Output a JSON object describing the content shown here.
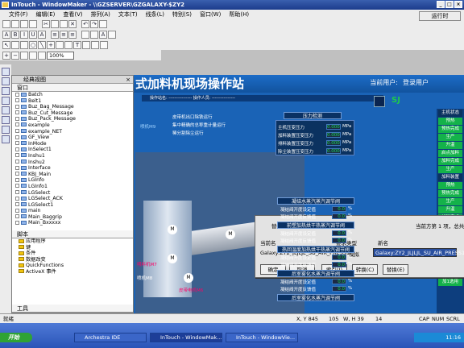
{
  "window": {
    "title": "InTouch - WindowMaker - \\\\GZSERVER\\GZGALAXY-$ZY2"
  },
  "menu": [
    "文件(F)",
    "编辑(E)",
    "查看(V)",
    "排列(A)",
    "文本(T)",
    "线条(L)",
    "特别(S)",
    "窗口(W)",
    "帮助(H)"
  ],
  "toolbar": {
    "run_label": "运行时",
    "zoom_value": "100%"
  },
  "classic_view": {
    "title": "经典视图",
    "window_header": "窗口",
    "script_header": "脚本",
    "tools_header": "工具"
  },
  "window_list": [
    "Batch",
    "Belt1",
    "Buz_Bag_Message",
    "Buz_Cut_Message",
    "Buz_Pack_Message",
    "example",
    "example_NET",
    "GF_View",
    "InMode",
    "InSelect1",
    "Inshu1",
    "Inshu2",
    "Interface",
    "KBJ_Main",
    "LGInfo",
    "LGInfo1",
    "LGSelect",
    "LGSelect_ACK",
    "LGSelect1",
    "main",
    "Main_Baggrip",
    "Main_Bxxxxx"
  ],
  "script_list": [
    "应用程序",
    "键",
    "条件",
    "数据改变",
    "QuickFunctions",
    "ActiveX 事件"
  ],
  "canvas": {
    "title": "式加料机现场操作站",
    "user_label": "当前用户:",
    "user_value": "登录用户",
    "subbar_text": "操作站名: ---------------- 操作人员: ----------------",
    "motor_lines": [
      "皮带机出口除铁运行",
      "集中精确的总称重计量运行",
      "稀分割除尘运行"
    ],
    "motor_labels": [
      "喷机M9",
      "喷机M8",
      "喂料机M7",
      "皮带电机M6"
    ],
    "tall_section": "压力检测",
    "pressure_rows": [
      {
        "label": "主机压变压力",
        "value": "0.000",
        "unit": "MPa"
      },
      {
        "label": "加料装置压变压力",
        "value": "0.000",
        "unit": "MPa"
      },
      {
        "label": "排料装置压变压力",
        "value": "0.000",
        "unit": "MPa"
      },
      {
        "label": "除尘装置压变压力",
        "value": "0.000",
        "unit": "MPa"
      }
    ],
    "sections": [
      {
        "title": "凝结水蒸汽蒸汽调节阀",
        "rows": [
          {
            "label": "凝结阀开度设定值",
            "value": "0.0",
            "unit": "%"
          },
          {
            "label": "凝结阀开度反馈值",
            "value": "0.0",
            "unit": "%"
          }
        ]
      },
      {
        "title": "前塑加热烘干热蒸汽调节阀",
        "rows": [
          {
            "label": "凝结阀开度设定值",
            "value": "0.0",
            "unit": "%"
          },
          {
            "label": "凝结阀开度反馈值",
            "value": "0.0",
            "unit": "%"
          }
        ]
      },
      {
        "title": "热回温度加热烘干热蒸汽调节阀",
        "rows": [
          {
            "label": "凝结阀开度设定值",
            "value": "0.0",
            "unit": "%"
          },
          {
            "label": "凝结阀开度反馈值",
            "value": "0.0",
            "unit": "%"
          }
        ]
      },
      {
        "title": "后室雾化水蒸汽调节阀",
        "rows": [
          {
            "label": "凝结阀开度设定值",
            "value": "0.0",
            "unit": "%"
          },
          {
            "label": "凝结阀开度反馈值",
            "value": "0.0",
            "unit": "%"
          }
        ]
      },
      {
        "title": "后室雾化水蒸汽调节阀",
        "rows": []
      }
    ],
    "right_buttons": [
      "主机状态",
      "预热",
      "预热完成",
      "生产",
      "升温",
      "启点加料",
      "加料完成",
      "生产",
      "加料装置",
      "预热",
      "预热完成",
      "生产",
      "升温",
      "加料完成",
      "生产",
      "讽1通风",
      "加1通风",
      "讽2通风",
      "过滤器通畅",
      "过滤器清理",
      "加3通风",
      "加1选用"
    ]
  },
  "dialog": {
    "title": "替换标记名...",
    "position": "当前方第 1 项，总共 1 项",
    "col_current": "当前名",
    "col_type": "要求类型",
    "col_new": "新名",
    "tag_name": "Galaxy:ZY2_JLJLJL_SU_AIR_PRESS1",
    "tag_type": "模拟",
    "new_name": "Galaxy:ZY2_JLJLJL_SU_AIR_PRESS1",
    "buttons": [
      "确定",
      "取消",
      "索引(I)",
      "转换(C)",
      "替换(E)"
    ]
  },
  "statusbar": {
    "left": "就绪",
    "x": "X, Y 845",
    "y": "105",
    "w": "W, H 39",
    "h": "14",
    "caps": "CAP",
    "num": "NUM",
    "scrl": "SCRL"
  },
  "taskbar": {
    "start": "开始",
    "tasks": [
      "Archestra IDE",
      "InTouch - WindowMak...",
      "InTouch - WindowVie..."
    ],
    "clock": "11:16"
  },
  "colors": {
    "titlebar": "#1c3c8c",
    "canvas_bg": "#1a63b6",
    "green_button": "#14b24a",
    "value_text": "#15e05c"
  }
}
